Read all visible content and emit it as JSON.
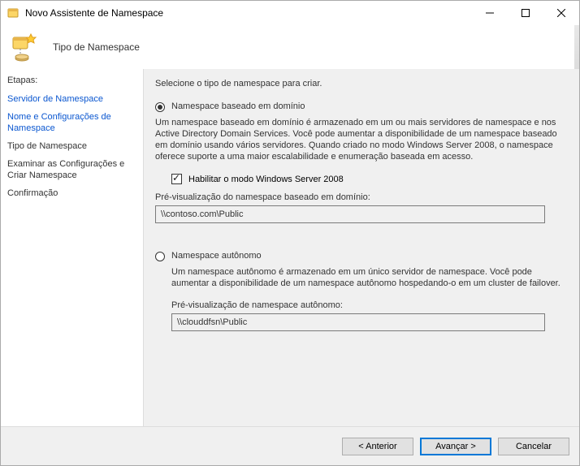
{
  "window": {
    "title": "Novo Assistente de Namespace"
  },
  "header": {
    "title": "Tipo de Namespace"
  },
  "sidebar": {
    "heading": "Etapas:",
    "steps": [
      {
        "label": "Servidor de Namespace",
        "kind": "link"
      },
      {
        "label": "Nome e Configurações de Namespace",
        "kind": "active"
      },
      {
        "label": "Tipo de Namespace",
        "kind": "plain"
      },
      {
        "label": "Examinar as Configurações e Criar Namespace",
        "kind": "plain"
      },
      {
        "label": "Confirmação",
        "kind": "plain"
      }
    ]
  },
  "main": {
    "instruction": "Selecione o tipo de namespace para criar.",
    "domain": {
      "label": "Namespace baseado em domínio",
      "description": "Um namespace baseado em domínio é armazenado em um ou mais servidores de namespace e nos Active Directory Domain Services. Você pode aumentar a disponibilidade de um namespace baseado em domínio usando vários servidores. Quando criado no modo Windows Server 2008, o namespace oferece suporte a uma maior escalabilidade e enumeração baseada em acesso.",
      "checkbox_label": "Habilitar o modo Windows Server 2008",
      "preview_label": "Pré-visualização do namespace baseado em domínio:",
      "preview_value": "\\\\contoso.com\\Public"
    },
    "standalone": {
      "label": "Namespace autônomo",
      "description": "Um namespace autônomo é armazenado em um único servidor de namespace. Você pode aumentar a disponibilidade de um namespace autônomo hospedando-o em um cluster de failover.",
      "preview_label": "Pré-visualização de namespace autônomo:",
      "preview_value": "\\\\clouddfsn\\Public"
    }
  },
  "footer": {
    "back": "<  Anterior",
    "next": "Avançar  >",
    "cancel": "Cancelar"
  }
}
